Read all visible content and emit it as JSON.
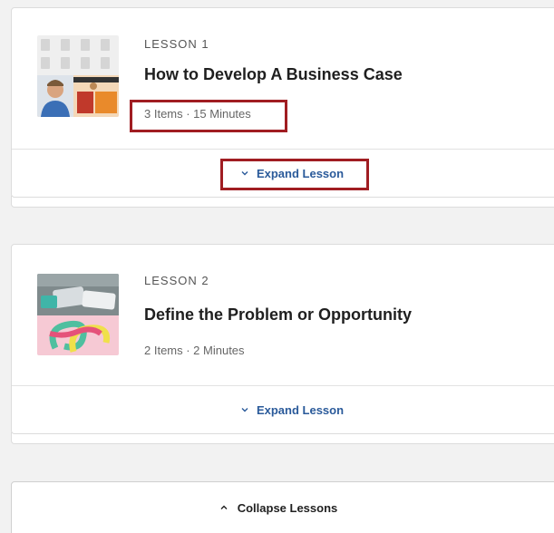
{
  "lessons": [
    {
      "number_label": "LESSON 1",
      "title": "How to Develop A Business Case",
      "meta": "3 Items · 15 Minutes",
      "expand_label": "Expand Lesson",
      "thumbnail_icon": "presenter-thumbnail-icon"
    },
    {
      "number_label": "LESSON 2",
      "title": "Define the Problem or Opportunity",
      "meta": "2 Items · 2 Minutes",
      "expand_label": "Expand Lesson",
      "thumbnail_icon": "knot-thumbnail-icon"
    }
  ],
  "collapse_label": "Collapse Lessons",
  "colors": {
    "accent": "#2a5a9a",
    "highlight": "#a01d22"
  }
}
